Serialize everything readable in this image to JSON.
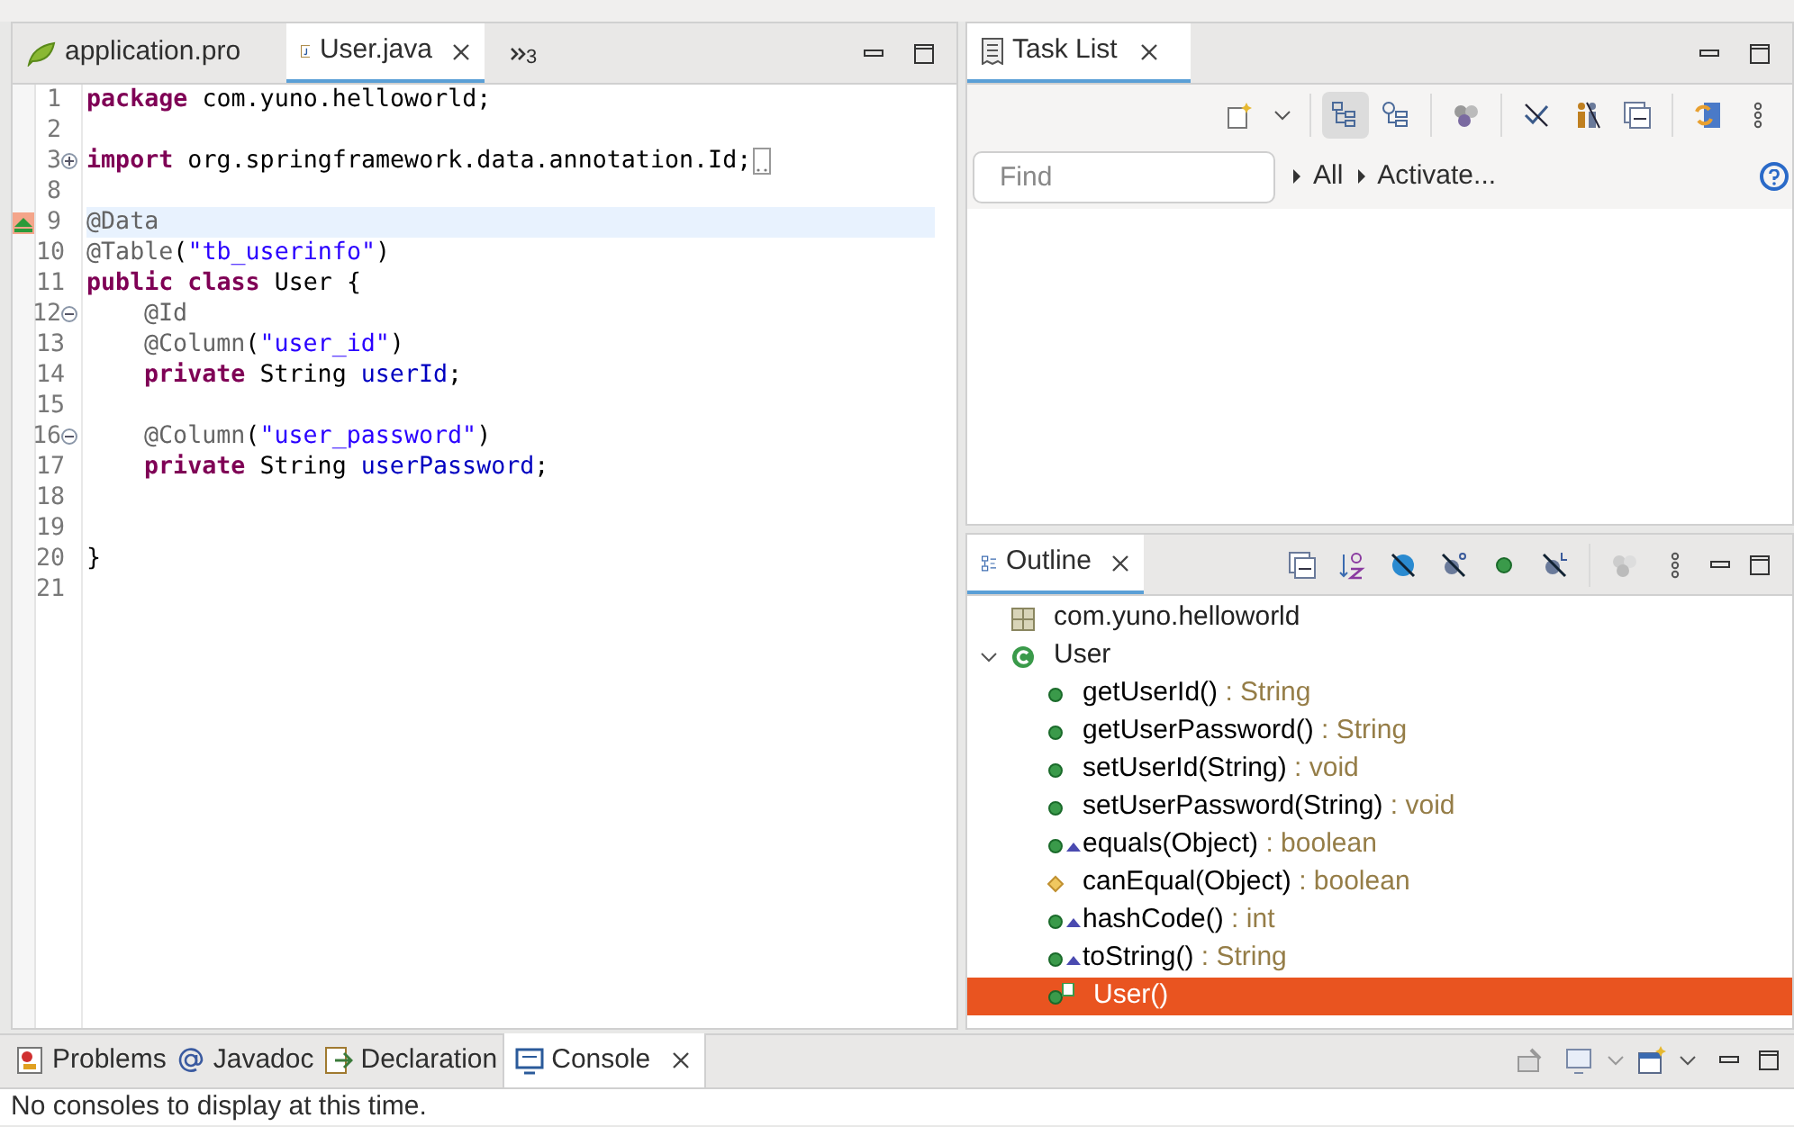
{
  "editor": {
    "tabs": [
      {
        "label": "application.pro",
        "kind": "properties",
        "selected": false,
        "closable": false
      },
      {
        "label": "User.java",
        "kind": "java",
        "selected": true,
        "closable": true
      }
    ],
    "overflow": "3",
    "lines": [
      {
        "num": "1",
        "tokens": [
          {
            "kind": "keyword",
            "text": "package"
          },
          {
            "kind": "plain",
            "text": " com.yuno.helloworld;"
          }
        ]
      },
      {
        "num": "2"
      },
      {
        "num": "3",
        "foldable": true,
        "collapsed": true,
        "folded_marker": true,
        "tokens": [
          {
            "kind": "keyword",
            "text": "import"
          },
          {
            "kind": "plain",
            "text": " org.springframework.data.annotation.Id;"
          }
        ]
      },
      {
        "num": "8"
      },
      {
        "num": "9",
        "current": true,
        "marker": true,
        "tokens": [
          {
            "kind": "annotation",
            "text": "@Data"
          }
        ]
      },
      {
        "num": "10",
        "tokens": [
          {
            "kind": "annotation",
            "text": "@Table"
          },
          {
            "kind": "plain",
            "text": "("
          },
          {
            "kind": "string",
            "text": "\"tb_userinfo\""
          },
          {
            "kind": "plain",
            "text": ")"
          }
        ]
      },
      {
        "num": "11",
        "tokens": [
          {
            "kind": "keyword",
            "text": "public class"
          },
          {
            "kind": "plain",
            "text": " User {"
          }
        ]
      },
      {
        "num": "12",
        "foldable": true,
        "collapsed": false,
        "indented": true,
        "tokens": [
          {
            "kind": "annotation",
            "text": "@Id"
          }
        ]
      },
      {
        "num": "13",
        "indented": true,
        "tokens": [
          {
            "kind": "annotation",
            "text": "@Column"
          },
          {
            "kind": "plain",
            "text": "("
          },
          {
            "kind": "string",
            "text": "\"user_id\""
          },
          {
            "kind": "plain",
            "text": ")"
          }
        ]
      },
      {
        "num": "14",
        "indented": true,
        "tokens": [
          {
            "kind": "keyword",
            "text": "private"
          },
          {
            "kind": "plain",
            "text": " String "
          },
          {
            "kind": "field",
            "text": "userId"
          },
          {
            "kind": "plain",
            "text": ";"
          }
        ]
      },
      {
        "num": "15"
      },
      {
        "num": "16",
        "foldable": true,
        "collapsed": false,
        "indented": true,
        "tokens": [
          {
            "kind": "annotation",
            "text": "@Column"
          },
          {
            "kind": "plain",
            "text": "("
          },
          {
            "kind": "string",
            "text": "\"user_password\""
          },
          {
            "kind": "plain",
            "text": ")"
          }
        ]
      },
      {
        "num": "17",
        "indented": true,
        "tokens": [
          {
            "kind": "keyword",
            "text": "private"
          },
          {
            "kind": "plain",
            "text": " String "
          },
          {
            "kind": "field",
            "text": "userPassword"
          },
          {
            "kind": "plain",
            "text": ";"
          }
        ]
      },
      {
        "num": "18"
      },
      {
        "num": "19"
      },
      {
        "num": "20",
        "tokens": [
          {
            "kind": "plain",
            "text": "}"
          }
        ]
      },
      {
        "num": "21"
      }
    ]
  },
  "task_list": {
    "tab": {
      "label": "Task List",
      "selected": true
    },
    "search": {
      "placeholder": "Find"
    },
    "links": [
      "All",
      "Activate..."
    ]
  },
  "outline": {
    "tab": {
      "label": "Outline",
      "selected": true
    },
    "items": [
      {
        "kind": "package",
        "name": "com.yuno.helloworld",
        "selected": false
      },
      {
        "kind": "class",
        "name": "User",
        "expanded": true,
        "selected": false,
        "children": [
          {
            "kind": "public",
            "name": "getUserId()",
            "type": " : String",
            "override": false,
            "selected": false
          },
          {
            "kind": "public",
            "name": "getUserPassword()",
            "type": " : String",
            "override": false,
            "selected": false
          },
          {
            "kind": "public",
            "name": "setUserId(String)",
            "type": " : void",
            "override": false,
            "selected": false
          },
          {
            "kind": "public",
            "name": "setUserPassword(String)",
            "type": " : void",
            "override": false,
            "selected": false
          },
          {
            "kind": "public",
            "name": "equals(Object)",
            "type": " : boolean",
            "override": true,
            "selected": false
          },
          {
            "kind": "protected",
            "name": "canEqual(Object)",
            "type": " : boolean",
            "override": false,
            "selected": false
          },
          {
            "kind": "public",
            "name": "hashCode()",
            "type": " : int",
            "override": true,
            "selected": false
          },
          {
            "kind": "public",
            "name": "toString()",
            "type": " : String",
            "override": true,
            "selected": false
          },
          {
            "kind": "constructor",
            "name": "User()",
            "selected": true
          }
        ]
      }
    ]
  },
  "bottom": {
    "tabs": [
      {
        "label": "Problems",
        "kind": "problems",
        "selected": false
      },
      {
        "label": "Javadoc",
        "kind": "javadoc",
        "selected": false
      },
      {
        "label": "Declaration",
        "kind": "declaration",
        "selected": false
      },
      {
        "label": "Console",
        "kind": "console",
        "selected": true
      }
    ],
    "message": "No consoles to display at this time."
  }
}
